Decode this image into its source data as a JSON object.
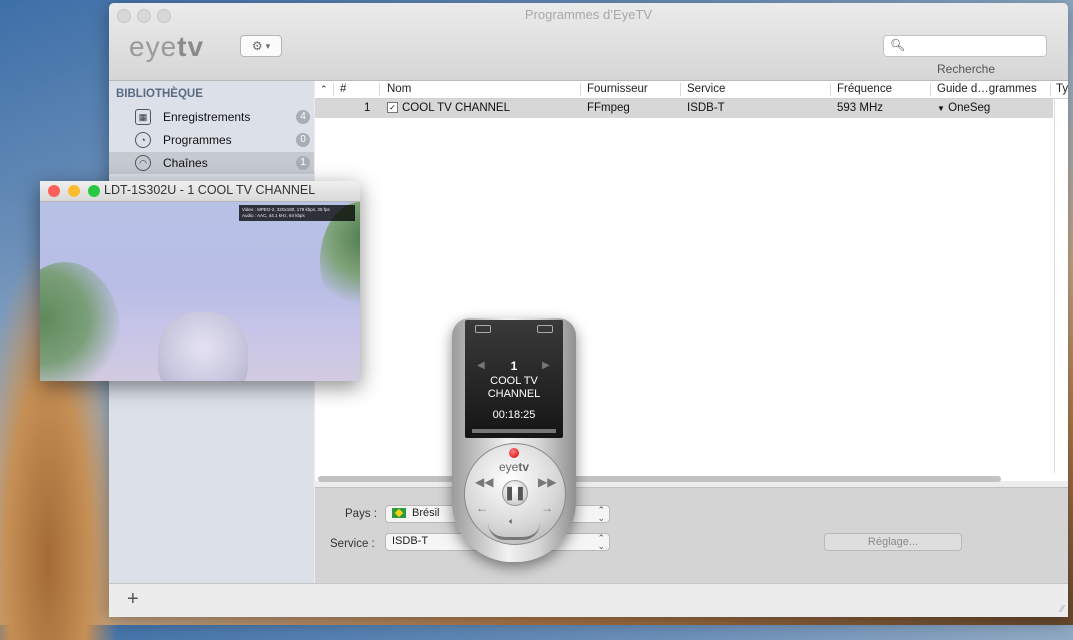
{
  "window": {
    "title": "Programmes d’EyeTV"
  },
  "toolbar": {
    "logo_light": "eye",
    "logo_bold": "tv",
    "gear_arrow": "▾",
    "search_placeholder": "",
    "search_label": "Recherche"
  },
  "sidebar": {
    "heading": "BIBLIOTHÈQUE",
    "items": [
      {
        "label": "Enregistrements",
        "count": "4",
        "icon": "film-icon"
      },
      {
        "label": "Programmes",
        "count": "0",
        "icon": "clock-icon"
      },
      {
        "label": "Chaînes",
        "count": "1",
        "icon": "dish-icon"
      }
    ]
  },
  "table": {
    "columns": [
      "#",
      "Nom",
      "Fournisseur",
      "Service",
      "Fréquence",
      "Guide d…grammes",
      "Ty"
    ],
    "rows": [
      {
        "num": "1",
        "nom": "COOL TV CHANNEL",
        "fournisseur": "FFmpeg",
        "service": "ISDB-T",
        "frequence": "593 MHz",
        "guide": "OneSeg"
      }
    ]
  },
  "settings": {
    "pays_label": "Pays :",
    "pays_value": "Brésil",
    "service_label": "Service :",
    "service_value": "ISDB-T",
    "reglage_label": "Réglage..."
  },
  "player": {
    "title": "LDT-1S302U - 1 COOL TV CHANNEL",
    "overlay_line1": "Video : MPEG-2, 320x180, 179 kbps, 25 fps",
    "overlay_line2": "Audio : AAC, 44.1 kHz, 64 kbps"
  },
  "remote": {
    "channel_number": "1",
    "channel_name": "COOL TV CHANNEL",
    "time": "00:18:25",
    "logo_light": "eye",
    "logo_bold": "tv"
  },
  "colors": {
    "close": "#fc5f57",
    "minimize": "#fdbc2e",
    "zoom": "#28c840",
    "selected_row": "#d7d7d7"
  }
}
